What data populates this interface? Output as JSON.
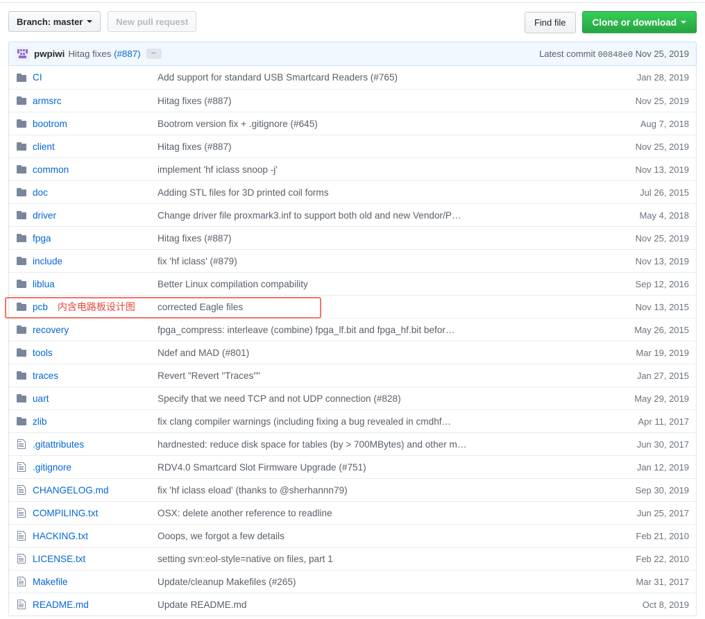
{
  "toolbar": {
    "branch_label": "Branch: master",
    "new_pull_request_label": "New pull request",
    "find_file_label": "Find file",
    "clone_or_download_label": "Clone or download"
  },
  "latest_commit": {
    "author": "pwpiwi",
    "message_text": "Hitag fixes ",
    "message_link": "(#887)",
    "ellipsis_badge": "…",
    "label": "Latest commit",
    "sha": "00848e0",
    "date": "Nov 25, 2019"
  },
  "annotation": {
    "text": "内含电路板设计图",
    "color": "#e8453c",
    "box_color": "#f1736a"
  },
  "files": [
    {
      "type": "folder",
      "name": "CI",
      "message": "Add support for standard USB Smartcard Readers (#765)",
      "date": "Jan 28, 2019"
    },
    {
      "type": "folder",
      "name": "armsrc",
      "message": "Hitag fixes (#887)",
      "date": "Nov 25, 2019"
    },
    {
      "type": "folder",
      "name": "bootrom",
      "message": "Bootrom version fix + .gitignore (#645)",
      "date": "Aug 7, 2018"
    },
    {
      "type": "folder",
      "name": "client",
      "message": "Hitag fixes (#887)",
      "date": "Nov 25, 2019"
    },
    {
      "type": "folder",
      "name": "common",
      "message": "implement 'hf iclass snoop -j'",
      "date": "Nov 13, 2019"
    },
    {
      "type": "folder",
      "name": "doc",
      "message": "Adding STL files for 3D printed coil forms",
      "date": "Jul 26, 2015"
    },
    {
      "type": "folder",
      "name": "driver",
      "message": "Change driver file proxmark3.inf to support both old and new Vendor/P…",
      "date": "May 4, 2018"
    },
    {
      "type": "folder",
      "name": "fpga",
      "message": "Hitag fixes (#887)",
      "date": "Nov 25, 2019"
    },
    {
      "type": "folder",
      "name": "include",
      "message": "fix 'hf iclass' (#879)",
      "date": "Nov 13, 2019"
    },
    {
      "type": "folder",
      "name": "liblua",
      "message": "Better Linux compilation compability",
      "date": "Sep 12, 2016"
    },
    {
      "type": "folder",
      "name": "pcb",
      "message": "corrected Eagle files",
      "date": "Nov 13, 2015",
      "note": "内含电路板设计图"
    },
    {
      "type": "folder",
      "name": "recovery",
      "message": "fpga_compress: interleave (combine) fpga_lf.bit and fpga_hf.bit befor…",
      "date": "May 26, 2015"
    },
    {
      "type": "folder",
      "name": "tools",
      "message": "Ndef and MAD (#801)",
      "date": "Mar 19, 2019"
    },
    {
      "type": "folder",
      "name": "traces",
      "message": "Revert \"Revert \"Traces\"\"",
      "date": "Jan 27, 2015"
    },
    {
      "type": "folder",
      "name": "uart",
      "message": "Specify that we need TCP and not UDP connection (#828)",
      "date": "May 29, 2019"
    },
    {
      "type": "folder",
      "name": "zlib",
      "message": "fix clang compiler warnings (including fixing a bug revealed in cmdhf…",
      "date": "Apr 11, 2017"
    },
    {
      "type": "file",
      "name": ".gitattributes",
      "message": "hardnested: reduce disk space for tables (by > 700MBytes) and other m…",
      "date": "Jun 30, 2017"
    },
    {
      "type": "file",
      "name": ".gitignore",
      "message": "RDV4.0 Smartcard Slot Firmware Upgrade (#751)",
      "date": "Jan 12, 2019"
    },
    {
      "type": "file",
      "name": "CHANGELOG.md",
      "message": "fix 'hf iclass eload' (thanks to @sherhannn79)",
      "date": "Sep 30, 2019"
    },
    {
      "type": "file",
      "name": "COMPILING.txt",
      "message": "OSX: delete another reference to readline",
      "date": "Jun 25, 2017"
    },
    {
      "type": "file",
      "name": "HACKING.txt",
      "message": "Ooops, we forgot a few details",
      "date": "Feb 21, 2010"
    },
    {
      "type": "file",
      "name": "LICENSE.txt",
      "message": "setting svn:eol-style=native on files, part 1",
      "date": "Feb 22, 2010"
    },
    {
      "type": "file",
      "name": "Makefile",
      "message": "Update/cleanup Makefiles (#265)",
      "date": "Mar 31, 2017"
    },
    {
      "type": "file",
      "name": "README.md",
      "message": "Update README.md",
      "date": "Oct 8, 2019"
    }
  ]
}
